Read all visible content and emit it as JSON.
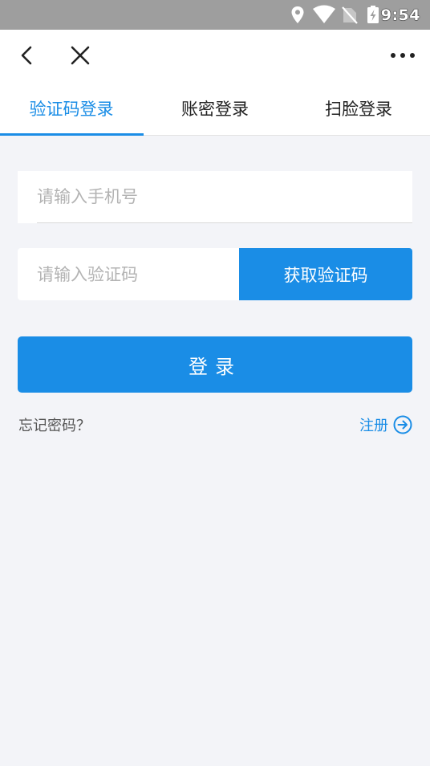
{
  "status_bar": {
    "time": "9:54",
    "icons": [
      "location-icon",
      "wifi-icon",
      "no-sim-icon",
      "battery-charging-icon"
    ]
  },
  "app_bar": {
    "icons": [
      "back-icon",
      "close-icon",
      "more-icon"
    ]
  },
  "tabs": [
    {
      "label": "验证码登录",
      "active": true
    },
    {
      "label": "账密登录",
      "active": false
    },
    {
      "label": "扫脸登录",
      "active": false
    }
  ],
  "form": {
    "phone_placeholder": "请输入手机号",
    "code_placeholder": "请输入验证码",
    "get_code_label": "获取验证码",
    "login_label": "登录",
    "forgot_label": "忘记密码？",
    "register_label": "注册"
  },
  "colors": {
    "accent": "#1a8de6",
    "background": "#f3f4f8",
    "status_bar": "#9e9e9e"
  }
}
